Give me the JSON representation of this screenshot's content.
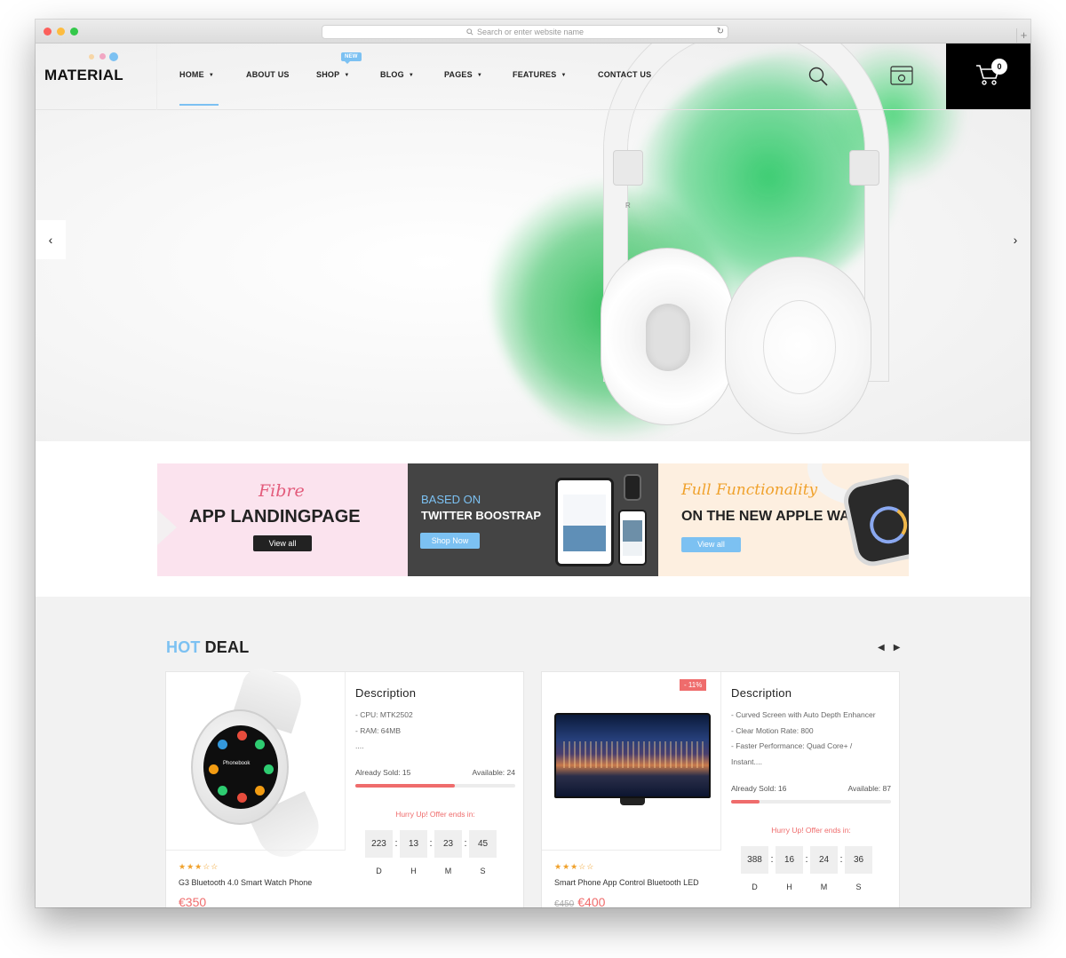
{
  "browser": {
    "url_placeholder": "Search or enter website name"
  },
  "header": {
    "logo": "MATERIAL",
    "nav": [
      {
        "label": "HOME",
        "caret": true,
        "active": true
      },
      {
        "label": "ABOUT US",
        "caret": false
      },
      {
        "label": "SHOP",
        "caret": true,
        "badge": "NEW"
      },
      {
        "label": "BLOG",
        "caret": true
      },
      {
        "label": "PAGES",
        "caret": true
      },
      {
        "label": "FEATURES",
        "caret": true
      },
      {
        "label": "CONTACT US",
        "caret": false
      }
    ],
    "cart_count": "0",
    "icons": [
      "search-icon",
      "settings-icon",
      "cart-icon"
    ],
    "accent_color": "#7cc1f2"
  },
  "hero": {
    "prev_arrow": "‹",
    "next_arrow": "›",
    "headphone_letter": "R"
  },
  "banners": [
    {
      "script": "Fibre",
      "title": "APP LANDINGPAGE",
      "button": "View all"
    },
    {
      "pre": "BASED ON",
      "title": "TWITTER BOOSTRAP",
      "button": "Shop Now"
    },
    {
      "script": "Full Functionality",
      "title": "ON THE NEW APPLE WATCH",
      "button": "View all"
    }
  ],
  "hot_deal": {
    "title_hot": "HOT",
    "title_deal": "DEAL",
    "products": [
      {
        "name": "G3 Bluetooth 4.0 Smart Watch Phone",
        "price": "€350",
        "old_price": "",
        "sale_badge": "",
        "rating": 3,
        "description_title": "Description",
        "description": [
          "- CPU: MTK2502",
          "- RAM: 64MB",
          "...."
        ],
        "already_sold": "Already Sold: 15",
        "available": "Available: 24",
        "sold_fraction": 0.62,
        "hurry": "Hurry Up! Offer ends in:",
        "countdown": {
          "d": "223",
          "h": "13",
          "m": "23",
          "s": "45"
        },
        "watch_label": "Phonebook"
      },
      {
        "name": "Smart Phone App Control Bluetooth LED",
        "price": "€400",
        "old_price": "€450",
        "sale_badge": "- 11%",
        "rating": 3,
        "description_title": "Description",
        "description": [
          "- Curved Screen with Auto Depth Enhancer",
          "- Clear Motion Rate: 800",
          "- Faster Performance: Quad Core+ /",
          "Instant...."
        ],
        "already_sold": "Already Sold: 16",
        "available": "Available: 87",
        "sold_fraction": 0.18,
        "hurry": "Hurry Up! Offer ends in:",
        "countdown": {
          "d": "388",
          "h": "16",
          "m": "24",
          "s": "36"
        }
      }
    ],
    "countdown_labels": {
      "d": "D",
      "h": "H",
      "m": "M",
      "s": "S"
    }
  }
}
